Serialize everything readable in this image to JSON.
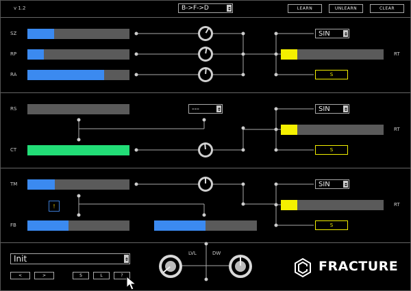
{
  "header": {
    "version": "v 1.2",
    "routing_select": "B->F->D",
    "learn": "LEARN",
    "unlearn": "UNLEARN",
    "clear": "CLEAR"
  },
  "section1": {
    "labels": {
      "sz": "SZ",
      "rp": "RP",
      "ra": "RA",
      "rt": "RT"
    },
    "sz_value": 0.26,
    "rp_value": 0.16,
    "ra_value": 0.75,
    "lfo_select": "SIN",
    "rt_value": 0.16,
    "s_button": "S"
  },
  "section2": {
    "labels": {
      "rs": "RS",
      "ct": "CT",
      "rt": "RT"
    },
    "rs_value": 0.0,
    "ct_value": 1.0,
    "mode_select": "---",
    "lfo_select": "SIN",
    "rt_value": 0.16,
    "s_button": "S"
  },
  "section3": {
    "labels": {
      "tm": "TM",
      "fb": "FB",
      "rt": "RT"
    },
    "tm_value": 0.27,
    "fb_value": 0.4,
    "mix_value": 0.5,
    "warn": "!",
    "lfo_select": "SIN",
    "rt_value": 0.16,
    "s_button": "S"
  },
  "footer": {
    "preset_select": "Init",
    "prev": "<",
    "next": ">",
    "save": "S",
    "load": "L",
    "help": "?",
    "lvl_label": "LVL",
    "dw_label": "DW",
    "brand": "FRACTURE"
  },
  "colors": {
    "blue": "#3b8af0",
    "green": "#22dd77",
    "yellow": "#f4f000",
    "track": "#5a5a5a"
  },
  "icons": {
    "knob": "rotary-knob-icon",
    "logo": "fracture-logo-icon",
    "cursor": "mouse-pointer-icon"
  }
}
